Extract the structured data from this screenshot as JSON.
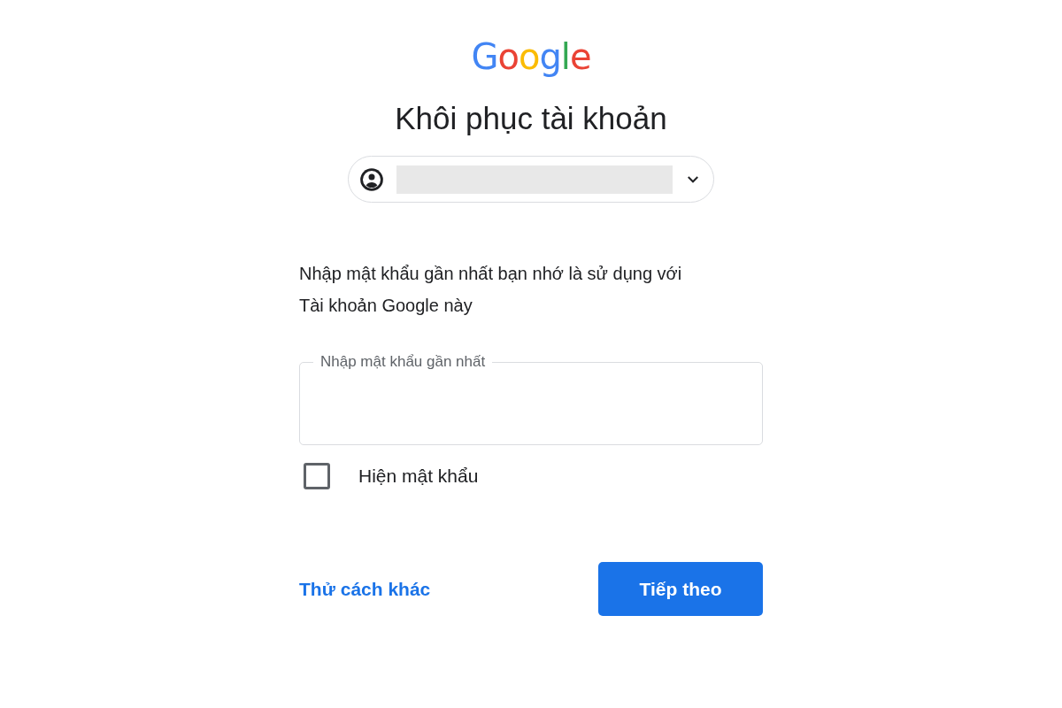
{
  "logo": [
    {
      "char": "G",
      "color": "#4285f4"
    },
    {
      "char": "o",
      "color": "#ea4335"
    },
    {
      "char": "o",
      "color": "#fbbc05"
    },
    {
      "char": "g",
      "color": "#4285f4"
    },
    {
      "char": "l",
      "color": "#34a853"
    },
    {
      "char": "e",
      "color": "#ea4335"
    }
  ],
  "title": "Khôi phục tài khoản",
  "account_chip": {
    "expanded": false
  },
  "instruction": "Nhập mật khẩu gần nhất bạn nhớ là sử dụng với Tài khoản Google này",
  "password_field": {
    "label": "Nhập mật khẩu gần nhất"
  },
  "show_password": {
    "label": "Hiện mật khẩu",
    "checked": false
  },
  "try_another_link": "Thử cách khác",
  "next_button": "Tiếp theo"
}
